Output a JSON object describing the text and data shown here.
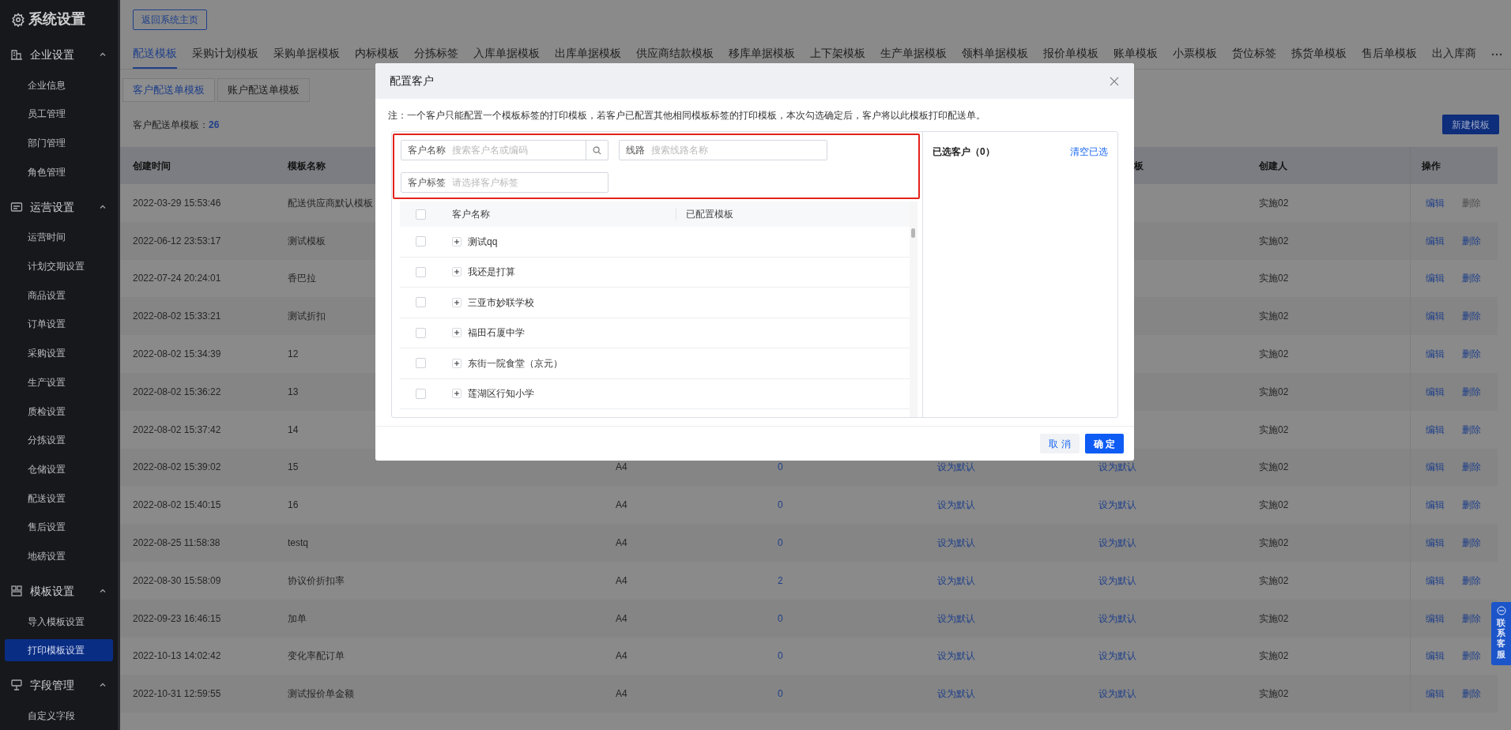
{
  "sidebar": {
    "title": "系统设置",
    "groups": [
      {
        "label": "企业设置",
        "kind": "building",
        "expanded": true,
        "items": [
          {
            "label": "企业信息",
            "selected": false
          },
          {
            "label": "员工管理",
            "selected": false
          },
          {
            "label": "部门管理",
            "selected": false
          },
          {
            "label": "角色管理",
            "selected": false
          }
        ]
      },
      {
        "label": "运营设置",
        "kind": "form",
        "expanded": true,
        "items": [
          {
            "label": "运营时间",
            "selected": false
          },
          {
            "label": "计划交期设置",
            "selected": false
          },
          {
            "label": "商品设置",
            "selected": false
          },
          {
            "label": "订单设置",
            "selected": false
          },
          {
            "label": "采购设置",
            "selected": false
          },
          {
            "label": "生产设置",
            "selected": false
          },
          {
            "label": "质检设置",
            "selected": false
          },
          {
            "label": "分拣设置",
            "selected": false
          },
          {
            "label": "仓储设置",
            "selected": false
          },
          {
            "label": "配送设置",
            "selected": false
          },
          {
            "label": "售后设置",
            "selected": false
          },
          {
            "label": "地磅设置",
            "selected": false
          }
        ]
      },
      {
        "label": "模板设置",
        "kind": "template",
        "expanded": true,
        "items": [
          {
            "label": "导入模板设置",
            "selected": false
          },
          {
            "label": "打印模板设置",
            "selected": true
          }
        ]
      },
      {
        "label": "字段管理",
        "kind": "field",
        "expanded": true,
        "items": [
          {
            "label": "自定义字段",
            "selected": false
          }
        ]
      }
    ]
  },
  "back_button": "返回系统主页",
  "tabs": [
    {
      "label": "配送模板",
      "selected": true
    },
    {
      "label": "采购计划模板",
      "selected": false
    },
    {
      "label": "采购单据模板",
      "selected": false
    },
    {
      "label": "内标模板",
      "selected": false
    },
    {
      "label": "分拣标签",
      "selected": false
    },
    {
      "label": "入库单据模板",
      "selected": false
    },
    {
      "label": "出库单据模板",
      "selected": false
    },
    {
      "label": "供应商结款模板",
      "selected": false
    },
    {
      "label": "移库单据模板",
      "selected": false
    },
    {
      "label": "上下架模板",
      "selected": false
    },
    {
      "label": "生产单据模板",
      "selected": false
    },
    {
      "label": "领料单据模板",
      "selected": false
    },
    {
      "label": "报价单模板",
      "selected": false
    },
    {
      "label": "账单模板",
      "selected": false
    },
    {
      "label": "小票模板",
      "selected": false
    },
    {
      "label": "货位标签",
      "selected": false
    },
    {
      "label": "拣货单模板",
      "selected": false
    },
    {
      "label": "售后单模板",
      "selected": false
    },
    {
      "label": "出入库商",
      "selected": false
    }
  ],
  "sub_tabs": [
    {
      "label": "客户配送单模板",
      "selected": true
    },
    {
      "label": "账户配送单模板",
      "selected": false
    }
  ],
  "template_count": {
    "label": "客户配送单模板：",
    "value": "26"
  },
  "new_button": "新建模板",
  "table": {
    "headers": {
      "created": "创建时间",
      "name": "模板名称",
      "column_6": "板",
      "creator": "创建人",
      "actions": "操作"
    },
    "rows": [
      {
        "created": "2022-03-29 15:53:46",
        "name": "配送供应商默认模板",
        "creator": "实施02",
        "edit": "编辑",
        "delete": {
          "label": "删除",
          "disabled": true
        }
      },
      {
        "created": "2022-06-12 23:53:17",
        "name": "测试模板",
        "creator": "实施02",
        "edit": "编辑",
        "delete": {
          "label": "删除",
          "disabled": false
        }
      },
      {
        "created": "2022-07-24 20:24:01",
        "name": "香巴拉",
        "creator": "实施02",
        "edit": "编辑",
        "delete": {
          "label": "删除",
          "disabled": false
        }
      },
      {
        "created": "2022-08-02 15:33:21",
        "name": "测试折扣",
        "creator": "实施02",
        "edit": "编辑",
        "delete": {
          "label": "删除",
          "disabled": false
        }
      },
      {
        "created": "2022-08-02 15:34:39",
        "name": "12",
        "creator": "实施02",
        "edit": "编辑",
        "delete": {
          "label": "删除",
          "disabled": false
        }
      },
      {
        "created": "2022-08-02 15:36:22",
        "name": "13",
        "creator": "实施02",
        "edit": "编辑",
        "delete": {
          "label": "删除",
          "disabled": false
        }
      },
      {
        "created": "2022-08-02 15:37:42",
        "name": "14",
        "creator": "实施02",
        "edit": "编辑",
        "delete": {
          "label": "删除",
          "disabled": false
        }
      },
      {
        "created": "2022-08-02 15:39:02",
        "name": "15",
        "paper": "A4",
        "count": "0",
        "default_a": "设为默认",
        "default_b": "设为默认",
        "creator": "实施02",
        "edit": "编辑",
        "delete": {
          "label": "删除",
          "disabled": false
        }
      },
      {
        "created": "2022-08-02 15:40:15",
        "name": "16",
        "paper": "A4",
        "count": "0",
        "default_a": "设为默认",
        "default_b": "设为默认",
        "creator": "实施02",
        "edit": "编辑",
        "delete": {
          "label": "删除",
          "disabled": false
        }
      },
      {
        "created": "2022-08-25 11:58:38",
        "name": "testq",
        "paper": "A4",
        "count": "0",
        "default_a": "设为默认",
        "default_b": "设为默认",
        "creator": "实施02",
        "edit": "编辑",
        "delete": {
          "label": "删除",
          "disabled": false
        }
      },
      {
        "created": "2022-08-30 15:58:09",
        "name": "协议价折扣率",
        "paper": "A4",
        "count": "2",
        "default_a": "设为默认",
        "default_b": "设为默认",
        "creator": "实施02",
        "edit": "编辑",
        "delete": {
          "label": "删除",
          "disabled": false
        }
      },
      {
        "created": "2022-09-23 16:46:15",
        "name": "加单",
        "paper": "A4",
        "count": "0",
        "default_a": "设为默认",
        "default_b": "设为默认",
        "creator": "实施02",
        "edit": "编辑",
        "delete": {
          "label": "删除",
          "disabled": false
        }
      },
      {
        "created": "2022-10-13 14:02:42",
        "name": "变化率配订单",
        "paper": "A4",
        "count": "0",
        "default_a": "设为默认",
        "default_b": "设为默认",
        "creator": "实施02",
        "edit": "编辑",
        "delete": {
          "label": "删除",
          "disabled": false
        }
      },
      {
        "created": "2022-10-31 12:59:55",
        "name": "测试报价单金额",
        "paper": "A4",
        "count": "0",
        "default_a": "设为默认",
        "default_b": "设为默认",
        "creator": "实施02",
        "edit": "编辑",
        "delete": {
          "label": "删除",
          "disabled": false
        }
      }
    ]
  },
  "dialog": {
    "title": "配置客户",
    "note": "注：一个客户只能配置一个模板标签的打印模板，若客户已配置其他相同模板标签的打印模板，本次勾选确定后，客户将以此模板打印配送单。",
    "filters_highlighted": true,
    "filters": [
      {
        "kind": "search",
        "label": "客户名称",
        "placeholder": "搜索客户名或编码"
      },
      {
        "kind": "input",
        "label": "线路",
        "placeholder": "搜索线路名称"
      },
      {
        "kind": "select",
        "label": "客户标签",
        "placeholder": "请选择客户标签"
      }
    ],
    "list": {
      "columns": [
        "客户名称",
        "已配置模板"
      ],
      "all_checked": false,
      "rows": [
        {
          "name": "测试qq",
          "checked": false,
          "expanded": false
        },
        {
          "name": "我还是打算",
          "checked": false,
          "expanded": false
        },
        {
          "name": "三亚市妙联学校",
          "checked": false,
          "expanded": false
        },
        {
          "name": "福田石厦中学",
          "checked": false,
          "expanded": false
        },
        {
          "name": "东街一院食堂（京元）",
          "checked": false,
          "expanded": false
        },
        {
          "name": "莲湖区行知小学",
          "checked": false,
          "expanded": false
        }
      ]
    },
    "selected_panel": {
      "title": "已选客户（0）",
      "clear": "清空已选"
    },
    "buttons": [
      {
        "label": "取 消",
        "kind": "secondary"
      },
      {
        "label": "确 定",
        "kind": "primary"
      }
    ]
  },
  "contact_button": "联系客服"
}
